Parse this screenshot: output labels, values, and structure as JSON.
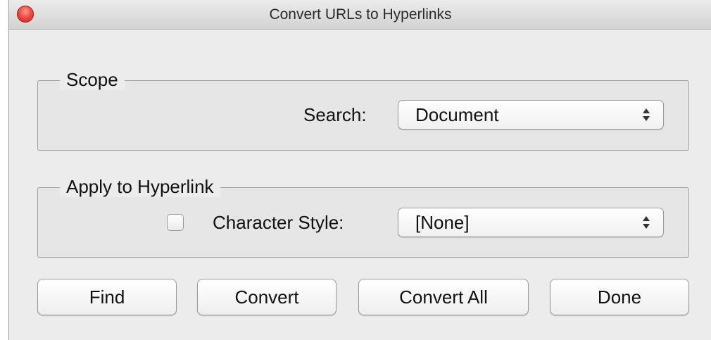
{
  "window": {
    "title": "Convert URLs to Hyperlinks"
  },
  "scope": {
    "legend": "Scope",
    "search_label": "Search:",
    "search_value": "Document"
  },
  "apply": {
    "legend": "Apply to Hyperlink",
    "character_style_label": "Character Style:",
    "character_style_value": "[None]",
    "character_style_checked": false
  },
  "buttons": {
    "find": "Find",
    "convert": "Convert",
    "convert_all": "Convert All",
    "done": "Done"
  },
  "icons": {
    "close": "close-icon",
    "popup_arrows": "up-down-arrows-icon"
  },
  "colors": {
    "close_red": "#f04a42",
    "window_bg": "#ececec"
  }
}
